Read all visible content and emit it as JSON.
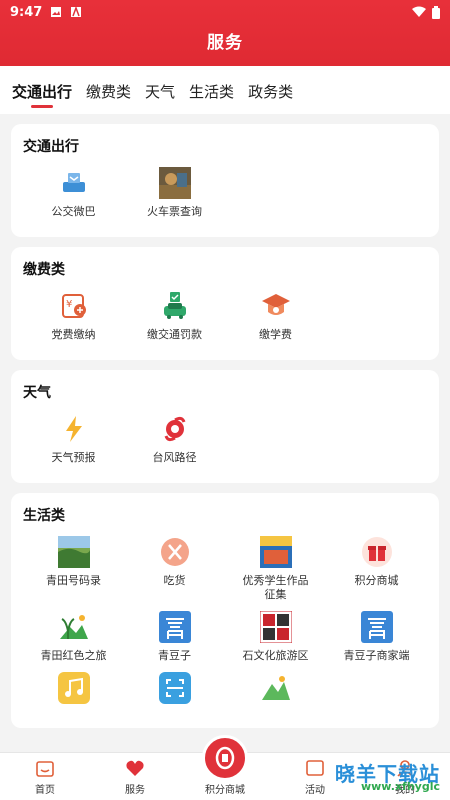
{
  "status_bar": {
    "time": "9:47"
  },
  "header": {
    "title": "服务"
  },
  "tabs": [
    {
      "label": "交通出行",
      "active": true
    },
    {
      "label": "缴费类"
    },
    {
      "label": "天气"
    },
    {
      "label": "生活类"
    },
    {
      "label": "政务类"
    }
  ],
  "sections": {
    "transport": {
      "title": "交通出行",
      "items": [
        {
          "label": "公交微巴",
          "icon": "bus-icon"
        },
        {
          "label": "火车票查询",
          "icon": "train-photo-icon"
        }
      ]
    },
    "payment": {
      "title": "缴费类",
      "items": [
        {
          "label": "党费缴纳",
          "icon": "party-fee-icon"
        },
        {
          "label": "缴交通罚款",
          "icon": "car-fine-icon"
        },
        {
          "label": "缴学费",
          "icon": "graduation-cap-icon"
        }
      ]
    },
    "weather": {
      "title": "天气",
      "items": [
        {
          "label": "天气预报",
          "icon": "lightning-icon"
        },
        {
          "label": "台风路径",
          "icon": "typhoon-icon"
        }
      ]
    },
    "life": {
      "title": "生活类",
      "items": [
        {
          "label": "青田号码录",
          "icon": "landscape-icon"
        },
        {
          "label": "吃货",
          "icon": "food-icon"
        },
        {
          "label": "优秀学生作品征集",
          "icon": "student-book-icon"
        },
        {
          "label": "积分商城",
          "icon": "gift-icon"
        },
        {
          "label": "青田红色之旅",
          "icon": "palm-tree-icon"
        },
        {
          "label": "青豆子",
          "icon": "qing-logo-icon"
        },
        {
          "label": "石文化旅游区",
          "icon": "stone-culture-icon"
        },
        {
          "label": "青豆子商家端",
          "icon": "qing-logo-icon"
        }
      ],
      "partial_icons": [
        "music-icon",
        "scan-icon",
        "mountain-icon"
      ]
    }
  },
  "bottom_nav": [
    {
      "label": "首页",
      "icon": "home-icon"
    },
    {
      "label": "服务",
      "icon": "heart-icon"
    },
    {
      "label": "积分商城",
      "icon": "mall-icon"
    },
    {
      "label": "活动",
      "icon": "activity-icon"
    },
    {
      "label": "我的",
      "icon": "user-icon"
    }
  ],
  "watermark": {
    "text": "晓羊下载站",
    "url": "www.xfhyglc"
  },
  "colors": {
    "brand_red": "#e0323a",
    "bg": "#f3f3f3"
  }
}
